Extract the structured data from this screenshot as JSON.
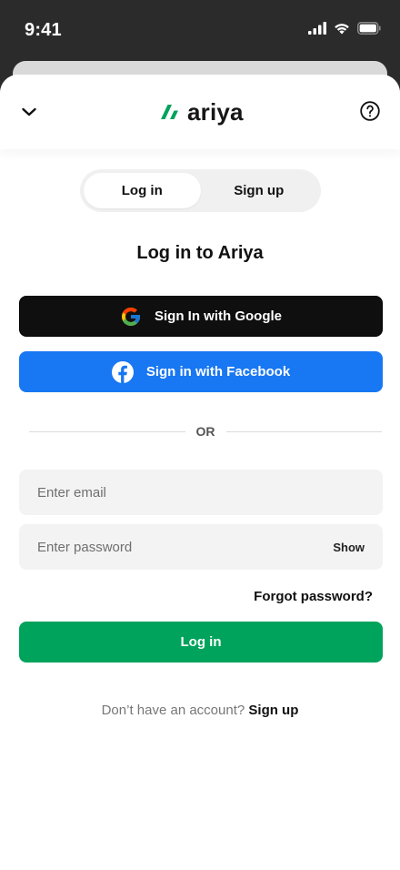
{
  "status_bar": {
    "time": "9:41"
  },
  "header": {
    "logo_text": "ariya",
    "brand_color": "#00a35c"
  },
  "tabs": [
    {
      "label": "Log in",
      "active": true
    },
    {
      "label": "Sign up",
      "active": false
    }
  ],
  "title": "Log in to Ariya",
  "social": {
    "google_label": "Sign In with Google",
    "facebook_label": "Sign in with Facebook",
    "facebook_color": "#1877f2"
  },
  "divider_text": "OR",
  "form": {
    "email_placeholder": "Enter email",
    "email_value": "",
    "password_placeholder": "Enter password",
    "password_value": "",
    "show_label": "Show",
    "forgot_label": "Forgot password?",
    "submit_label": "Log in"
  },
  "footer": {
    "prompt": "Don’t have an account?",
    "link": "Sign up"
  },
  "icons": {
    "back": "chevron-down-icon",
    "help": "help-circle-icon",
    "google": "google-icon",
    "facebook": "facebook-icon"
  }
}
